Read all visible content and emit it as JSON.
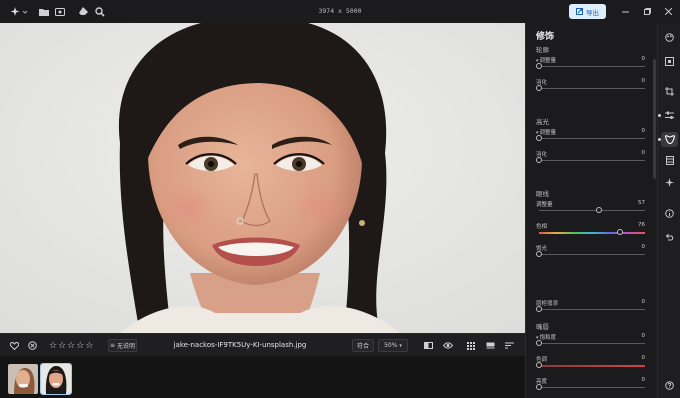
{
  "topbar": {
    "dimensions": "3974 x 5000",
    "export_label": "导出"
  },
  "bottombar": {
    "rating_stars": 5,
    "description_button": "无说明",
    "filename": "jake-nackos-IF9TK5Uy-KI-unsplash.jpg",
    "fit_button": "符合",
    "zoom": "50%"
  },
  "panel": {
    "title": "修饰",
    "sections": [
      {
        "title": "轮廓",
        "rows": [
          {
            "label": "调整量",
            "value": "0",
            "caret": true,
            "level": 0,
            "track": "plain"
          },
          {
            "label": "羽化",
            "value": "0",
            "caret": false,
            "level": 0,
            "track": "plain"
          }
        ]
      },
      {
        "title": "高光",
        "rows": [
          {
            "label": "调整量",
            "value": "0",
            "caret": true,
            "level": 0,
            "track": "plain"
          },
          {
            "label": "羽化",
            "value": "0",
            "caret": false,
            "level": 0,
            "track": "plain"
          }
        ]
      },
      {
        "title": "眼线",
        "rows": [
          {
            "label": "调整量",
            "value": "57",
            "caret": false,
            "level": 0.57,
            "track": "plain"
          },
          {
            "label": "色相",
            "value": "76",
            "caret": false,
            "level": 0.76,
            "track": "hue"
          },
          {
            "label": "饱光",
            "value": "0",
            "caret": false,
            "level": 0,
            "track": "plain"
          }
        ]
      },
      {
        "title": "",
        "rows": [
          {
            "label": "层柜增添",
            "value": "0",
            "caret": false,
            "level": 0,
            "track": "plain"
          }
        ]
      },
      {
        "title": "嘴唇",
        "rows": [
          {
            "label": "饱和度",
            "value": "0",
            "caret": true,
            "level": 0,
            "track": "plain"
          },
          {
            "label": "色调",
            "value": "0",
            "caret": false,
            "level": 0,
            "track": "red"
          },
          {
            "label": "亮度",
            "value": "0",
            "caret": false,
            "level": 0,
            "track": "plain"
          }
        ]
      }
    ]
  },
  "icons": {
    "topbar": [
      "magic-wand-icon",
      "folder-icon",
      "image-icon",
      "eraser-icon",
      "search-icon"
    ],
    "rail": [
      "color-palette-icon",
      "crop-frame-icon",
      "crop-icon",
      "sliders-icon",
      "face-retouch-icon",
      "grid-icon",
      "sparkle-icon",
      "info-icon",
      "undo-icon",
      "help-icon"
    ]
  },
  "colors": {
    "export_bg": "#dfeefe",
    "export_text": "#1a5fb4",
    "panel_bg": "#1b1b1d"
  }
}
